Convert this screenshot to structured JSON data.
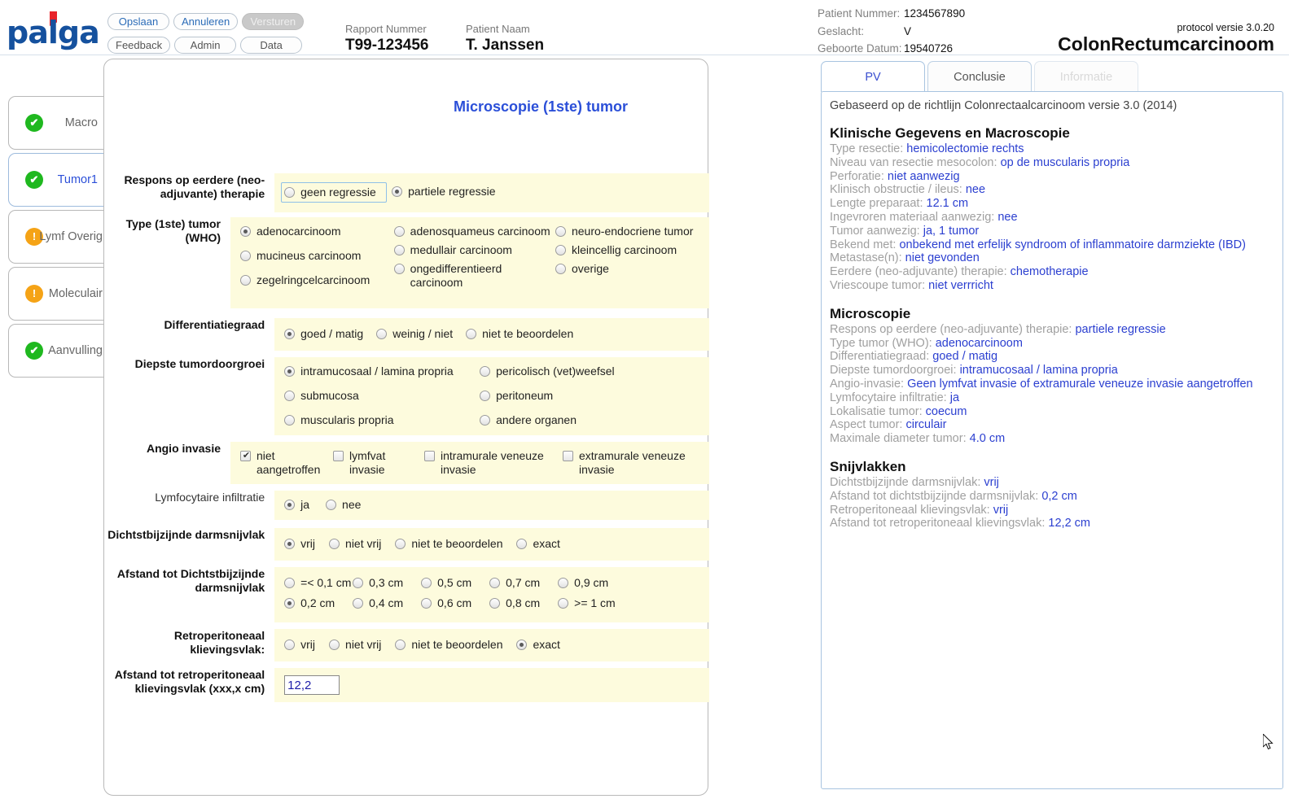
{
  "brand": {
    "name": "palga"
  },
  "toolbar": {
    "row1": [
      {
        "label": "Opslaan",
        "state": "normal"
      },
      {
        "label": "Annuleren",
        "state": "normal"
      },
      {
        "label": "Versturen",
        "state": "disabled"
      }
    ],
    "row2": [
      {
        "label": "Feedback",
        "state": "gray"
      },
      {
        "label": "Admin",
        "state": "gray"
      },
      {
        "label": "Data",
        "state": "gray"
      }
    ]
  },
  "header": {
    "rapport_label": "Rapport Nummer",
    "rapport_value": "T99-123456",
    "patient_label": "Patient Naam",
    "patient_value": "T. Janssen",
    "meta": [
      {
        "key": "Patient Nummer:",
        "value": "1234567890"
      },
      {
        "key": "Geslacht:",
        "value": "V"
      },
      {
        "key": "Geboorte Datum:",
        "value": "19540726"
      }
    ],
    "protocol_version": "protocol versie 3.0.20",
    "protocol_name": "ColonRectumcarcinoom"
  },
  "sidebar": {
    "items": [
      {
        "label": "Macro",
        "status": "ok",
        "glyph": "✔",
        "active": false
      },
      {
        "label": "Tumor1",
        "status": "ok",
        "glyph": "✔",
        "active": true
      },
      {
        "label": "Lymf Overig",
        "status": "warn",
        "glyph": "!",
        "active": false
      },
      {
        "label": "Moleculair",
        "status": "warn",
        "glyph": "!",
        "active": false
      },
      {
        "label": "Aanvulling",
        "status": "ok",
        "glyph": "✔",
        "active": false
      }
    ]
  },
  "form": {
    "title": "Microscopie (1ste) tumor",
    "respons": {
      "label": "Respons op eerdere (neo-adjuvante) therapie",
      "options": [
        {
          "label": "geen regressie",
          "checked": false,
          "focused": true
        },
        {
          "label": "partiele regressie",
          "checked": true,
          "focused": false
        }
      ]
    },
    "type_tumor": {
      "label": "Type (1ste) tumor (WHO)",
      "col1": [
        {
          "label": "adenocarcinoom",
          "checked": true
        },
        {
          "label": "mucineus carcinoom",
          "checked": false
        },
        {
          "label": "zegelringcelcarcinoom",
          "checked": false
        }
      ],
      "col2": [
        {
          "label": "adenosquameus carcinoom",
          "checked": false
        },
        {
          "label": "medullair carcinoom",
          "checked": false
        },
        {
          "label": "ongedifferentieerd carcinoom",
          "checked": false
        }
      ],
      "col3": [
        {
          "label": "neuro-endocriene tumor",
          "checked": false
        },
        {
          "label": "kleincellig carcinoom",
          "checked": false
        },
        {
          "label": "overige",
          "checked": false
        }
      ]
    },
    "differentiatie": {
      "label": "Differentiatiegraad",
      "options": [
        {
          "label": "goed / matig",
          "checked": true
        },
        {
          "label": "weinig / niet",
          "checked": false
        },
        {
          "label": "niet te beoordelen",
          "checked": false
        }
      ]
    },
    "diepste": {
      "label": "Diepste tumordoorgroei",
      "col1": [
        {
          "label": "intramucosaal / lamina propria",
          "checked": true
        },
        {
          "label": "submucosa",
          "checked": false
        },
        {
          "label": "muscularis propria",
          "checked": false
        }
      ],
      "col2": [
        {
          "label": "pericolisch (vet)weefsel",
          "checked": false
        },
        {
          "label": "peritoneum",
          "checked": false
        },
        {
          "label": "andere organen",
          "checked": false
        }
      ]
    },
    "angio": {
      "label": "Angio invasie",
      "options": [
        {
          "label": "niet aangetroffen",
          "checked": true
        },
        {
          "label": "lymfvat invasie",
          "checked": false
        },
        {
          "label": "intramurale veneuze invasie",
          "checked": false
        },
        {
          "label": "extramurale veneuze invasie",
          "checked": false
        }
      ]
    },
    "lymfocytaire": {
      "label": "Lymfocytaire infiltratie",
      "options": [
        {
          "label": "ja",
          "checked": true
        },
        {
          "label": "nee",
          "checked": false
        }
      ]
    },
    "dichtstbij": {
      "label": "Dichtstbijzijnde darmsnijvlak",
      "options": [
        {
          "label": "vrij",
          "checked": true
        },
        {
          "label": "niet vrij",
          "checked": false
        },
        {
          "label": "niet te beoordelen",
          "checked": false
        },
        {
          "label": "exact",
          "checked": false
        }
      ]
    },
    "afstand_dichtstbij": {
      "label": "Afstand tot Dichtstbijzijnde darmsnijvlak",
      "row1": [
        {
          "label": "=< 0,1 cm",
          "checked": false
        },
        {
          "label": "0,3 cm",
          "checked": false
        },
        {
          "label": "0,5 cm",
          "checked": false
        },
        {
          "label": "0,7 cm",
          "checked": false
        },
        {
          "label": "0,9 cm",
          "checked": false
        }
      ],
      "row2": [
        {
          "label": "0,2 cm",
          "checked": true
        },
        {
          "label": "0,4 cm",
          "checked": false
        },
        {
          "label": "0,6 cm",
          "checked": false
        },
        {
          "label": "0,8 cm",
          "checked": false
        },
        {
          "label": ">= 1 cm",
          "checked": false
        }
      ]
    },
    "retroperitoneaal": {
      "label": "Retroperitoneaal klievingsvlak:",
      "options": [
        {
          "label": "vrij",
          "checked": false
        },
        {
          "label": "niet vrij",
          "checked": false
        },
        {
          "label": "niet te beoordelen",
          "checked": false
        },
        {
          "label": "exact",
          "checked": true
        }
      ]
    },
    "afstand_retro": {
      "label": "Afstand tot retroperitoneaal klievingsvlak (xxx,x cm)",
      "value": "12,2"
    }
  },
  "right": {
    "tabs": [
      {
        "label": "PV",
        "state": "active"
      },
      {
        "label": "Conclusie",
        "state": "normal"
      },
      {
        "label": "Informatie",
        "state": "disabled"
      }
    ],
    "intro": "Gebaseerd op de richtlijn Colonrectaalcarcinoom versie 3.0 (2014)",
    "groups": [
      {
        "heading": "Klinische Gegevens en Macroscopie",
        "lines": [
          {
            "k": "Type resectie: ",
            "v": "hemicolectomie rechts"
          },
          {
            "k": "Niveau van resectie mesocolon: ",
            "v": "op de muscularis propria"
          },
          {
            "k": "Perforatie: ",
            "v": "niet aanwezig"
          },
          {
            "k": "Klinisch obstructie / ileus: ",
            "v": "nee"
          },
          {
            "k": "Lengte preparaat: ",
            "v": "12.1 cm"
          },
          {
            "k": "Ingevroren materiaal aanwezig: ",
            "v": "nee"
          },
          {
            "k": "Tumor aanwezig: ",
            "v": "ja, 1 tumor"
          },
          {
            "k": "Bekend met: ",
            "v": "onbekend met erfelijk syndroom of inflammatoire darmziekte (IBD)"
          },
          {
            "k": "Metastase(n): ",
            "v": "niet gevonden"
          },
          {
            "k": "Eerdere (neo-adjuvante) therapie: ",
            "v": "chemotherapie"
          },
          {
            "k": "Vriescoupe tumor: ",
            "v": "niet verrricht"
          }
        ]
      },
      {
        "heading": "Microscopie",
        "lines": [
          {
            "k": "Respons op eerdere (neo-adjuvante) therapie: ",
            "v": "partiele regressie"
          },
          {
            "k": "Type tumor (WHO): ",
            "v": "adenocarcinoom"
          },
          {
            "k": "Differentiatiegraad: ",
            "v": "goed / matig"
          },
          {
            "k": "Diepste tumordoorgroei: ",
            "v": "intramucosaal / lamina propria"
          },
          {
            "k": "Angio-invasie: ",
            "v": "Geen lymfvat invasie of extramurale veneuze invasie aangetroffen"
          },
          {
            "k": "Lymfocytaire infiltratie: ",
            "v": "ja"
          },
          {
            "k": "Lokalisatie tumor: ",
            "v": "coecum"
          },
          {
            "k": "Aspect tumor: ",
            "v": "circulair"
          },
          {
            "k": "Maximale diameter tumor: ",
            "v": "4.0 cm"
          }
        ]
      },
      {
        "heading": "Snijvlakken",
        "lines": [
          {
            "k": "Dichtstbijzijnde darmsnijvlak: ",
            "v": "vrij"
          },
          {
            "k": "Afstand tot dichtstbijzijnde darmsnijvlak: ",
            "v": "0,2 cm"
          },
          {
            "k": "Retroperitoneaal klievingsvlak: ",
            "v": "vrij"
          },
          {
            "k": "Afstand tot retroperitoneaal klievingsvlak: ",
            "v": "12,2 cm"
          }
        ]
      }
    ]
  }
}
